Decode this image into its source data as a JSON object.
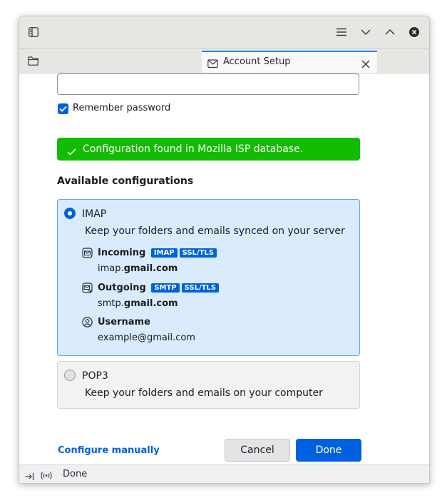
{
  "titlebar": {
    "sidebar_icon": "sidebar-icon",
    "menu_icon": "hamburger-icon",
    "minimize_icon": "chevron-down-icon",
    "maximize_icon": "chevron-up-icon",
    "close_icon": "close-circle-icon"
  },
  "tabs": {
    "folder_icon": "folder-icon",
    "active_tab": {
      "title": "Account Setup",
      "icon": "mail-icon",
      "close_icon": "close-icon"
    }
  },
  "form": {
    "password_value": "",
    "remember_password_label": "Remember password",
    "remember_password_checked": true
  },
  "banner": {
    "text": "Configuration found in Mozilla ISP database.",
    "icon": "check-icon",
    "color": "#12bc00"
  },
  "configs": {
    "heading": "Available configurations",
    "imap": {
      "title": "IMAP",
      "selected": true,
      "description": "Keep your folders and emails synced on your server",
      "incoming_label": "Incoming",
      "incoming_badges": [
        "IMAP",
        "SSL/TLS"
      ],
      "incoming_host_prefix": "imap.",
      "incoming_host_domain": "gmail.com",
      "outgoing_label": "Outgoing",
      "outgoing_badges": [
        "SMTP",
        "SSL/TLS"
      ],
      "outgoing_host_prefix": "smtp.",
      "outgoing_host_domain": "gmail.com",
      "username_label": "Username",
      "username_value": "example@gmail.com"
    },
    "pop3": {
      "title": "POP3",
      "selected": false,
      "description": "Keep your folders and emails on your computer"
    }
  },
  "actions": {
    "configure_manually": "Configure manually",
    "cancel": "Cancel",
    "done": "Done",
    "accent": "#0061e0"
  },
  "statusbar": {
    "text": "Done",
    "collapse_icon": "arrow-to-right-icon",
    "online_icon": "broadcast-icon"
  }
}
